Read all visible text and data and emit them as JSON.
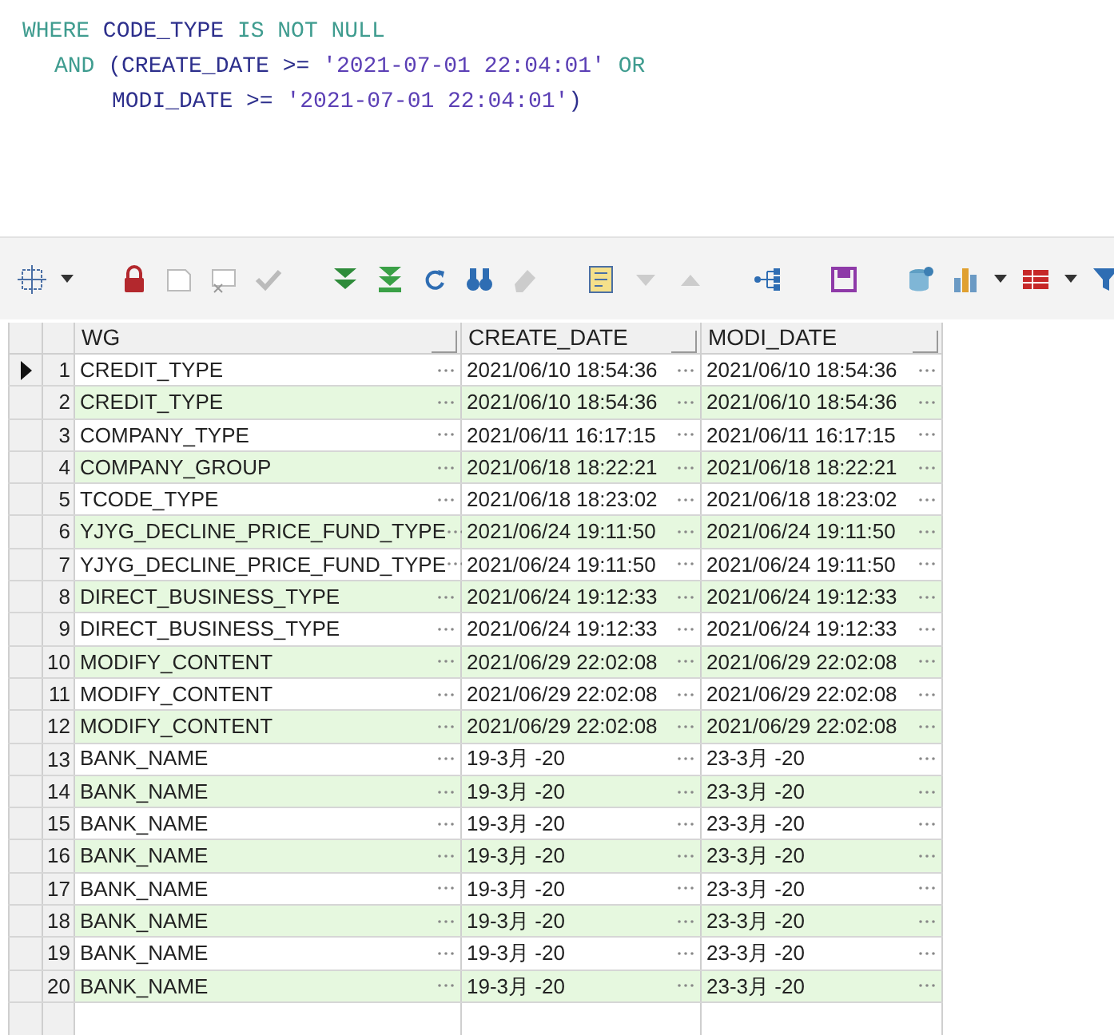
{
  "sql": [
    {
      "tokens": [
        {
          "kind": "keyword",
          "text": "WHERE"
        },
        {
          "kind": "ident",
          "text": " CODE_TYPE "
        },
        {
          "kind": "keyword",
          "text": "IS NOT NULL"
        }
      ],
      "children": [
        {
          "tokens": [
            {
              "kind": "keyword",
              "text": "AND"
            },
            {
              "kind": "ident",
              "text": " (CREATE_DATE >= "
            },
            {
              "kind": "string",
              "text": "'2021-07-01 22:04:01'"
            },
            {
              "kind": "keyword",
              "text": " OR"
            }
          ],
          "children": [
            {
              "tokens": [
                {
                  "kind": "ident",
                  "text": "MODI_DATE >= "
                },
                {
                  "kind": "string",
                  "text": "'2021-07-01 22:04:01'"
                },
                {
                  "kind": "ident",
                  "text": ")"
                }
              ]
            }
          ]
        }
      ]
    }
  ],
  "table": {
    "columns": [
      "WG",
      "CREATE_DATE",
      "MODI_DATE"
    ],
    "rows": [
      {
        "num": "1",
        "selected": true,
        "cells": [
          "CREDIT_TYPE",
          "2021/06/10 18:54:36",
          "2021/06/10 18:54:36"
        ]
      },
      {
        "num": "2",
        "selected": false,
        "cells": [
          "CREDIT_TYPE",
          "2021/06/10 18:54:36",
          "2021/06/10 18:54:36"
        ]
      },
      {
        "num": "3",
        "selected": false,
        "cells": [
          "COMPANY_TYPE",
          "2021/06/11 16:17:15",
          "2021/06/11 16:17:15"
        ]
      },
      {
        "num": "4",
        "selected": false,
        "cells": [
          "COMPANY_GROUP",
          "2021/06/18 18:22:21",
          "2021/06/18 18:22:21"
        ]
      },
      {
        "num": "5",
        "selected": false,
        "cells": [
          "TCODE_TYPE",
          "2021/06/18 18:23:02",
          "2021/06/18 18:23:02"
        ]
      },
      {
        "num": "6",
        "selected": false,
        "cells": [
          "YJYG_DECLINE_PRICE_FUND_TYPE",
          "2021/06/24 19:11:50",
          "2021/06/24 19:11:50"
        ]
      },
      {
        "num": "7",
        "selected": false,
        "cells": [
          "YJYG_DECLINE_PRICE_FUND_TYPE",
          "2021/06/24 19:11:50",
          "2021/06/24 19:11:50"
        ]
      },
      {
        "num": "8",
        "selected": false,
        "cells": [
          "DIRECT_BUSINESS_TYPE",
          "2021/06/24 19:12:33",
          "2021/06/24 19:12:33"
        ]
      },
      {
        "num": "9",
        "selected": false,
        "cells": [
          "DIRECT_BUSINESS_TYPE",
          "2021/06/24 19:12:33",
          "2021/06/24 19:12:33"
        ]
      },
      {
        "num": "10",
        "selected": false,
        "cells": [
          "MODIFY_CONTENT",
          "2021/06/29 22:02:08",
          "2021/06/29 22:02:08"
        ]
      },
      {
        "num": "11",
        "selected": false,
        "cells": [
          "MODIFY_CONTENT",
          "2021/06/29 22:02:08",
          "2021/06/29 22:02:08"
        ]
      },
      {
        "num": "12",
        "selected": false,
        "cells": [
          "MODIFY_CONTENT",
          "2021/06/29 22:02:08",
          "2021/06/29 22:02:08"
        ]
      },
      {
        "num": "13",
        "selected": false,
        "cells": [
          "BANK_NAME",
          "19-3月 -20",
          "23-3月 -20"
        ]
      },
      {
        "num": "14",
        "selected": false,
        "cells": [
          "BANK_NAME",
          "19-3月 -20",
          "23-3月 -20"
        ]
      },
      {
        "num": "15",
        "selected": false,
        "cells": [
          "BANK_NAME",
          "19-3月 -20",
          "23-3月 -20"
        ]
      },
      {
        "num": "16",
        "selected": false,
        "cells": [
          "BANK_NAME",
          "19-3月 -20",
          "23-3月 -20"
        ]
      },
      {
        "num": "17",
        "selected": false,
        "cells": [
          "BANK_NAME",
          "19-3月 -20",
          "23-3月 -20"
        ]
      },
      {
        "num": "18",
        "selected": false,
        "cells": [
          "BANK_NAME",
          "19-3月 -20",
          "23-3月 -20"
        ]
      },
      {
        "num": "19",
        "selected": false,
        "cells": [
          "BANK_NAME",
          "19-3月 -20",
          "23-3月 -20"
        ]
      },
      {
        "num": "20",
        "selected": false,
        "cells": [
          "BANK_NAME",
          "19-3月 -20",
          "23-3月 -20"
        ]
      }
    ]
  }
}
